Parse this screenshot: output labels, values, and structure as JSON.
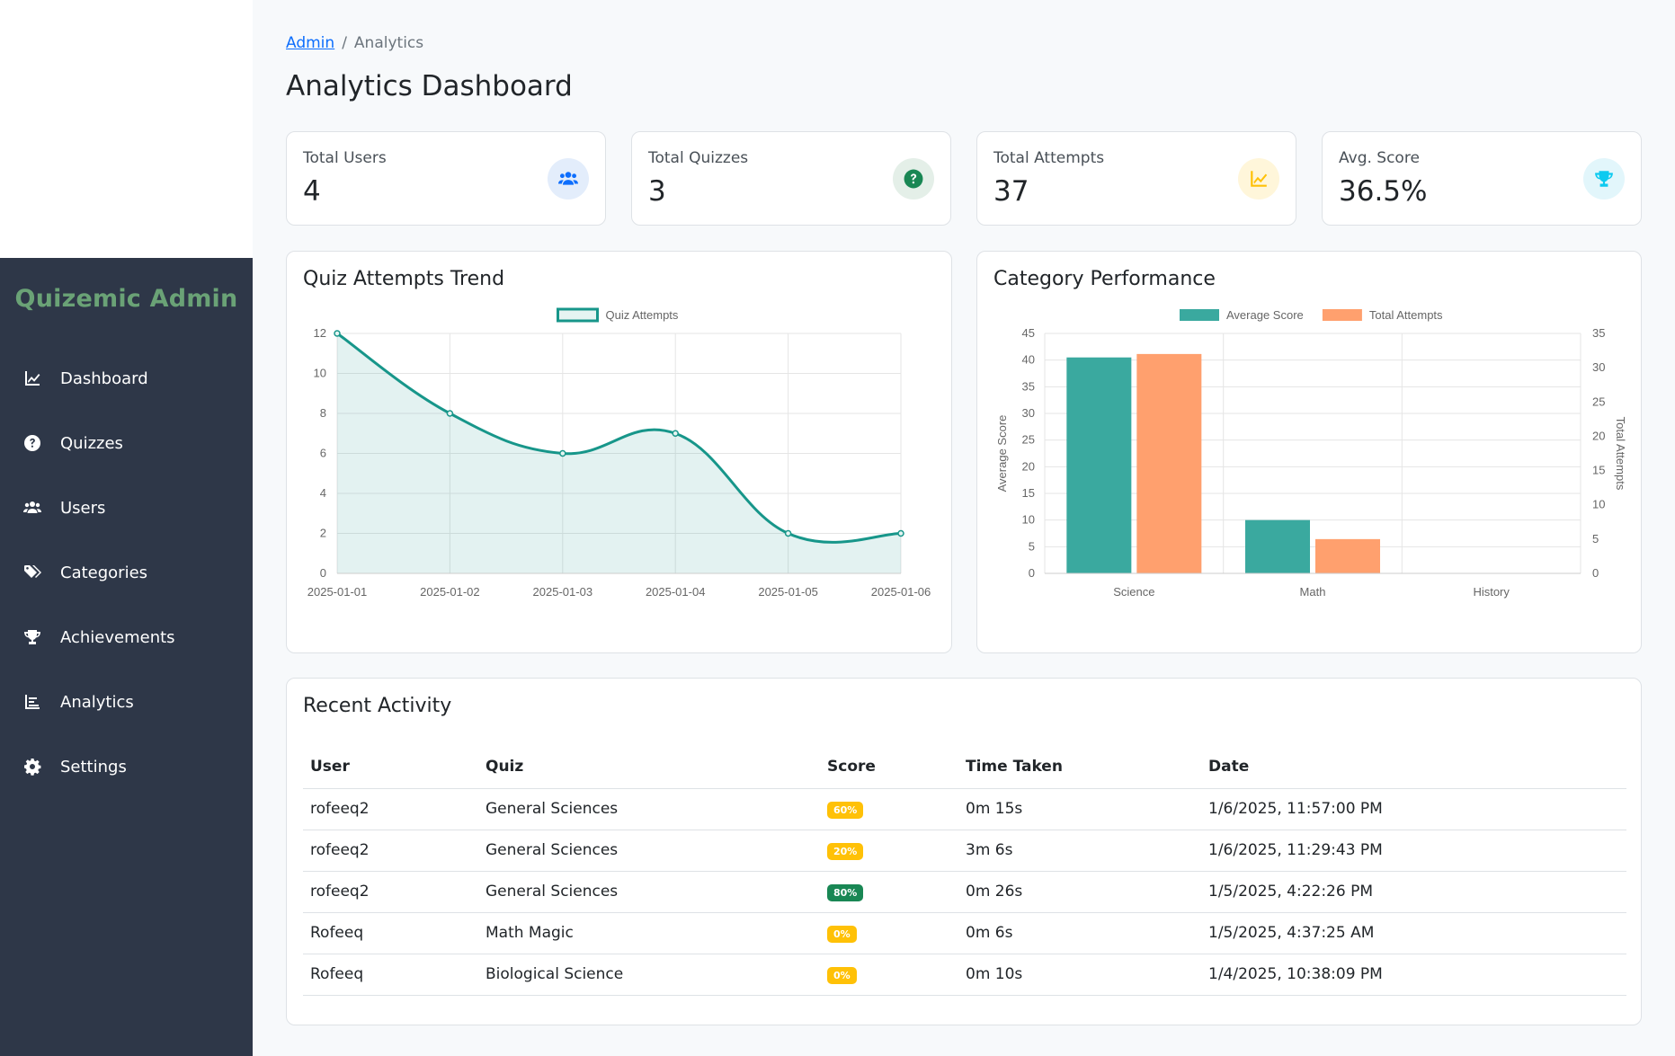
{
  "sidebar": {
    "brand": "Quizemic Admin",
    "items": [
      {
        "label": "Dashboard",
        "icon": "chart-line-icon"
      },
      {
        "label": "Quizzes",
        "icon": "question-circle-icon"
      },
      {
        "label": "Users",
        "icon": "users-icon"
      },
      {
        "label": "Categories",
        "icon": "tags-icon"
      },
      {
        "label": "Achievements",
        "icon": "trophy-icon"
      },
      {
        "label": "Analytics",
        "icon": "chart-bar-icon"
      },
      {
        "label": "Settings",
        "icon": "gear-icon"
      }
    ]
  },
  "breadcrumb": {
    "root": "Admin",
    "separator": "/",
    "current": "Analytics"
  },
  "page_title": "Analytics Dashboard",
  "stats": [
    {
      "label": "Total Users",
      "value": "4",
      "icon": "users-icon",
      "color": "#0d6efd",
      "bg": "#e3edfb"
    },
    {
      "label": "Total Quizzes",
      "value": "3",
      "icon": "question-circle-icon",
      "color": "#198754",
      "bg": "#e4efe8"
    },
    {
      "label": "Total Attempts",
      "value": "37",
      "icon": "chart-line-icon",
      "color": "#ffc107",
      "bg": "#fff6da"
    },
    {
      "label": "Avg. Score",
      "value": "36.5%",
      "icon": "trophy-icon",
      "color": "#0dcaf0",
      "bg": "#e2f6fb"
    }
  ],
  "trend_card": {
    "title": "Quiz Attempts Trend"
  },
  "category_card": {
    "title": "Category Performance"
  },
  "chart_data": [
    {
      "type": "line",
      "x": [
        "2025-01-01",
        "2025-01-02",
        "2025-01-03",
        "2025-01-04",
        "2025-01-05",
        "2025-01-06"
      ],
      "series": [
        {
          "name": "Quiz Attempts",
          "values": [
            12,
            8,
            6,
            7,
            2,
            2
          ],
          "color": "#17968a"
        }
      ],
      "ylim": [
        0,
        12
      ],
      "yticks": [
        0,
        2,
        4,
        6,
        8,
        10,
        12
      ],
      "fill": true,
      "legend": "top-center",
      "grid": true
    },
    {
      "type": "bar",
      "categories": [
        "Science",
        "Math",
        "History"
      ],
      "series": [
        {
          "name": "Average Score",
          "values": [
            40.5,
            10,
            0
          ],
          "color": "#3aa99f",
          "axis": "left"
        },
        {
          "name": "Total Attempts",
          "values": [
            32,
            5,
            0
          ],
          "color": "#ffa06e",
          "axis": "right"
        }
      ],
      "ylabel": "Average Score",
      "ylabel_right": "Total Attempts",
      "ylim": [
        0,
        45
      ],
      "yticks": [
        0,
        5,
        10,
        15,
        20,
        25,
        30,
        35,
        40,
        45
      ],
      "ylim_right": [
        0,
        35
      ],
      "yticks_right": [
        0,
        5,
        10,
        15,
        20,
        25,
        30,
        35
      ],
      "legend": "top-center",
      "grid": true
    }
  ],
  "recent": {
    "title": "Recent Activity",
    "columns": [
      "User",
      "Quiz",
      "Score",
      "Time Taken",
      "Date"
    ],
    "rows": [
      {
        "user": "rofeeq2",
        "quiz": "General Sciences",
        "score": "60%",
        "status": "warn",
        "time": "0m 15s",
        "date": "1/6/2025, 11:57:00 PM"
      },
      {
        "user": "rofeeq2",
        "quiz": "General Sciences",
        "score": "20%",
        "status": "warn",
        "time": "3m 6s",
        "date": "1/6/2025, 11:29:43 PM"
      },
      {
        "user": "rofeeq2",
        "quiz": "General Sciences",
        "score": "80%",
        "status": "ok",
        "time": "0m 26s",
        "date": "1/5/2025, 4:22:26 PM"
      },
      {
        "user": "Rofeeq",
        "quiz": "Math Magic",
        "score": "0%",
        "status": "warn",
        "time": "0m 6s",
        "date": "1/5/2025, 4:37:25 AM"
      },
      {
        "user": "Rofeeq",
        "quiz": "Biological Science",
        "score": "0%",
        "status": "warn",
        "time": "0m 10s",
        "date": "1/4/2025, 10:38:09 PM"
      }
    ]
  }
}
